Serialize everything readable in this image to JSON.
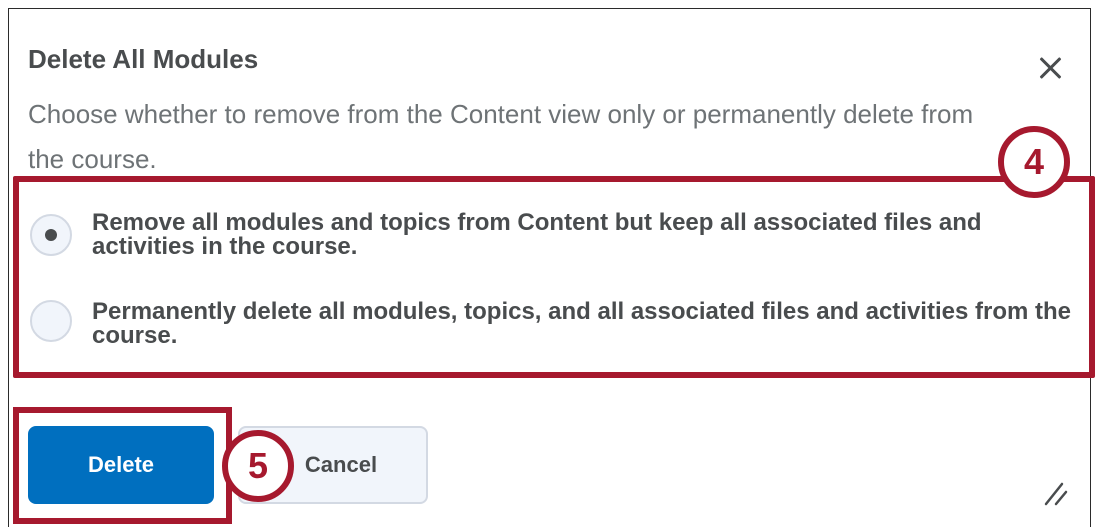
{
  "dialog": {
    "title": "Delete All Modules",
    "description": "Choose whether to remove from the Content view only or permanently delete from the course.",
    "close_icon": "close-icon",
    "options": [
      {
        "label": "Remove all modules and topics from Content but keep all associated files and activities in the course.",
        "selected": true
      },
      {
        "label": "Permanently delete all modules, topics, and all associated files and activities from the course.",
        "selected": false
      }
    ],
    "buttons": {
      "delete_label": "Delete",
      "cancel_label": "Cancel"
    },
    "resize_icon": "resize-handle-icon"
  },
  "callouts": {
    "step_options": "4",
    "step_delete": "5",
    "color": "#a6192e"
  },
  "colors": {
    "primary_button": "#006fbf",
    "text": "#494c4e"
  }
}
